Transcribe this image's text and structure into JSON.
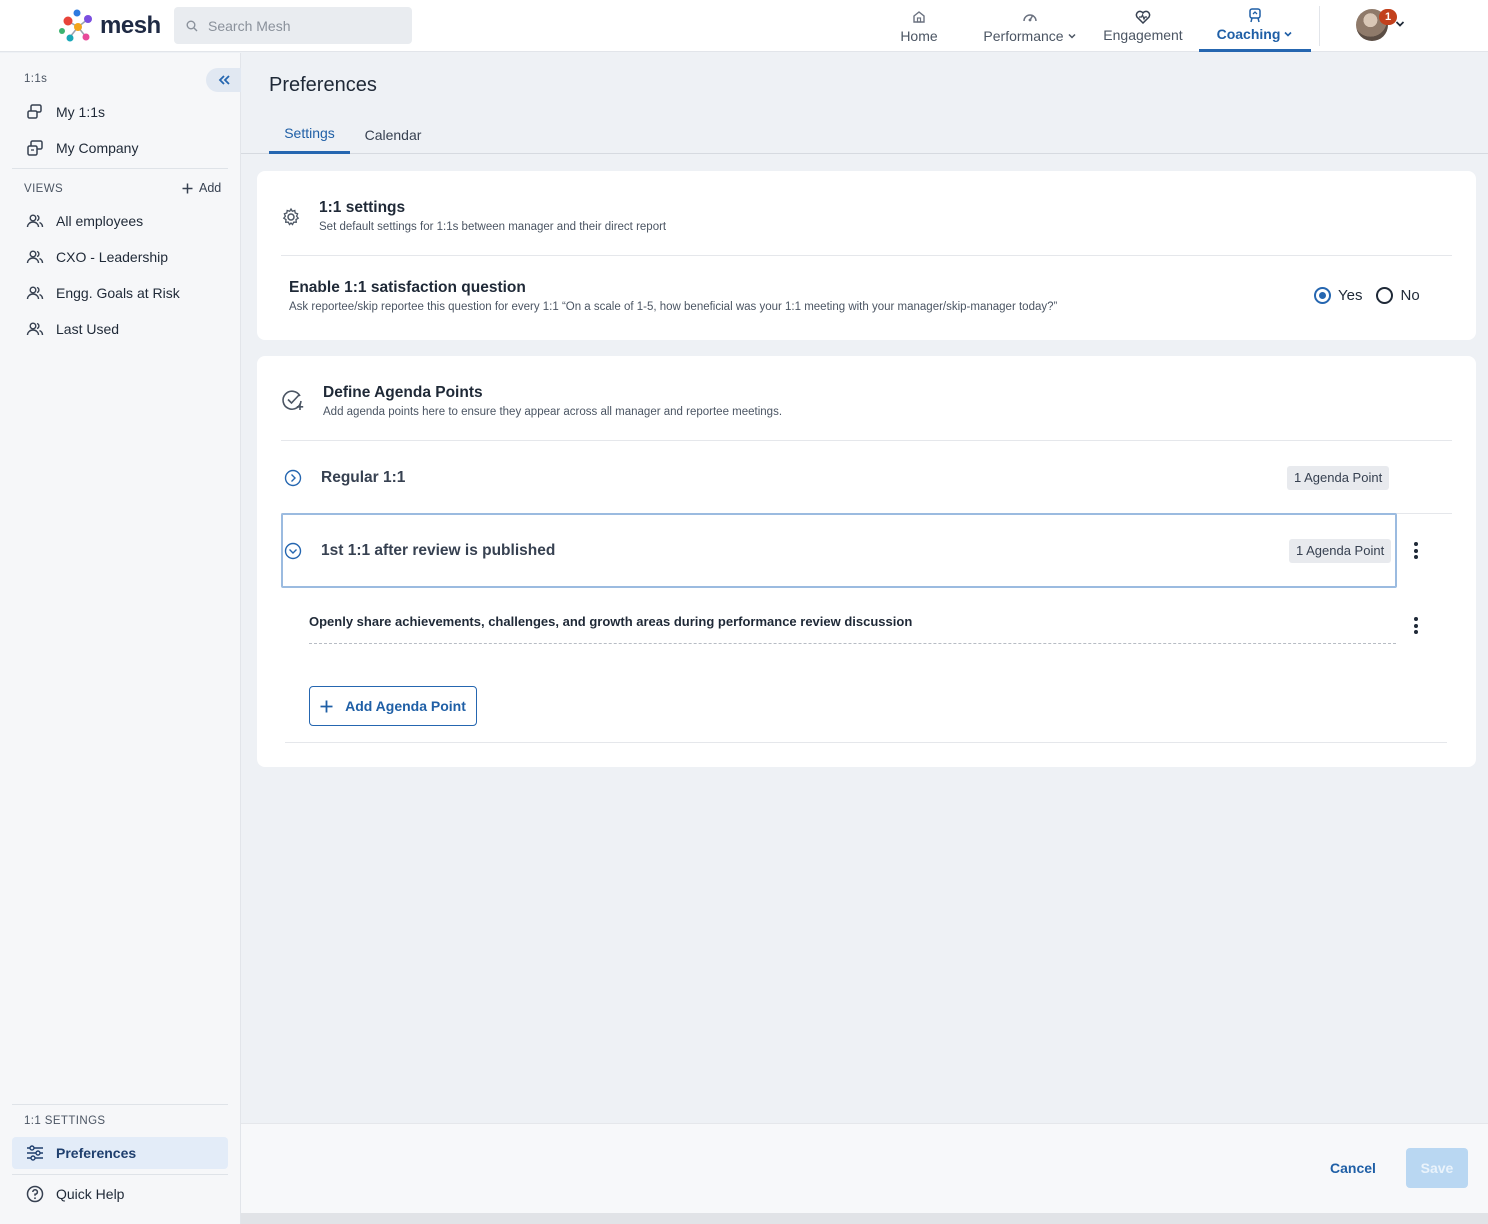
{
  "brand": {
    "name": "mesh"
  },
  "search": {
    "placeholder": "Search Mesh"
  },
  "nav": {
    "home": "Home",
    "performance": "Performance",
    "engagement": "Engagement",
    "coaching": "Coaching",
    "notification_count": "1"
  },
  "sidebar": {
    "section_1on1": "1:1s",
    "my_1on1s": "My 1:1s",
    "my_company": "My Company",
    "views_label": "VIEWS",
    "add_label": "Add",
    "views": [
      "All employees",
      "CXO - Leadership",
      "Engg. Goals at Risk",
      "Last Used"
    ],
    "settings_label": "1:1 SETTINGS",
    "preferences": "Preferences",
    "quick_help": "Quick Help"
  },
  "page": {
    "title": "Preferences",
    "tabs": [
      "Settings",
      "Calendar"
    ]
  },
  "settings_card": {
    "title": "1:1 settings",
    "subtitle": "Set default settings for 1:1s between manager and their direct report",
    "question_title": "Enable 1:1 satisfaction question",
    "question_desc": "Ask reportee/skip reportee this question for every 1:1 “On a scale of 1-5, how beneficial was your 1:1 meeting with your manager/skip-manager today?”",
    "yes": "Yes",
    "no": "No"
  },
  "agenda_card": {
    "title": "Define Agenda Points",
    "subtitle": "Add agenda points here to ensure they appear across all manager and reportee meetings.",
    "groups": [
      {
        "name": "Regular 1:1",
        "count": "1 Agenda Point"
      },
      {
        "name": "1st 1:1 after review is published",
        "count": "1 Agenda Point"
      }
    ],
    "point": "Openly share achievements, challenges, and growth areas during performance review discussion",
    "add_button": "Add Agenda Point"
  },
  "footer": {
    "cancel": "Cancel",
    "save": "Save"
  },
  "colors": {
    "accent": "#2566b0",
    "badge": "#c2401c",
    "save_disabled": "#b9d7f2"
  }
}
